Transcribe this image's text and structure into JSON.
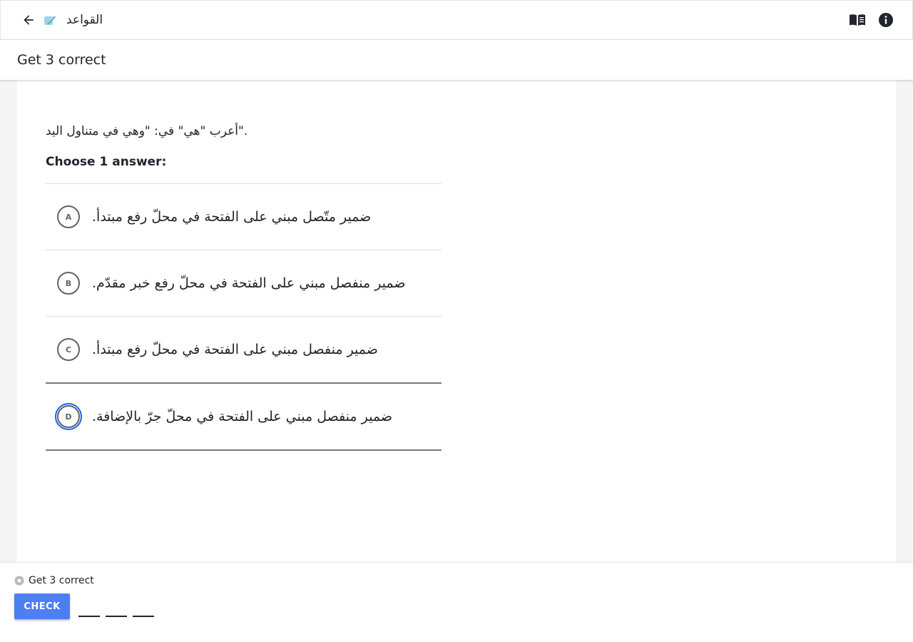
{
  "topbar": {
    "title": "القواعد",
    "back_icon": "arrow-left-icon",
    "exercise_icon": "pencil-icon",
    "glossary_icon": "book-icon",
    "info_icon": "info-icon"
  },
  "subheader": {
    "title": "Get 3 correct"
  },
  "question": {
    "prompt": "أعرب \"هي\" في: \"وهي في متناول اليد\".",
    "instruction": "Choose 1 answer:",
    "choices": [
      {
        "letter": "A",
        "text": "ضمير متّصل مبني على الفتحة في محلّ رفع مبتدأ."
      },
      {
        "letter": "B",
        "text": "ضمير منفصل مبني على الفتحة في محلّ رفع خبر مقدّم."
      },
      {
        "letter": "C",
        "text": "ضمير منفصل مبني على الفتحة في محلّ رفع مبتدأ."
      },
      {
        "letter": "D",
        "text": "ضمير منفصل مبني على الفتحة في محلّ جرّ بالإضافة."
      }
    ],
    "selected": "D"
  },
  "footer": {
    "goal_text": "Get 3 correct",
    "check_label": "CHECK",
    "progress_filled": 0,
    "progress_total": 3
  },
  "colors": {
    "accent": "#1865f2",
    "check_button": "#4d7ef2",
    "text": "#21242c"
  }
}
